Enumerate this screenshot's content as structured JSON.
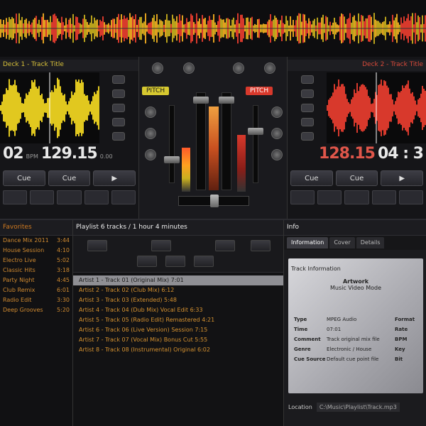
{
  "deck_left": {
    "title": "Deck 1 - Track Title",
    "time": "02",
    "bpm_label": "BPM",
    "bpm": "129.15",
    "pitch_suffix": "0.00",
    "cue_labels": [
      "Cue",
      "Cue",
      "▶"
    ],
    "color": "#e1c81f"
  },
  "deck_right": {
    "title": "Deck 2 - Track Title",
    "bpm": "128.15",
    "time": "04 : 3",
    "cue_labels": [
      "Cue",
      "Cue",
      "▶"
    ],
    "color": "#d8392c"
  },
  "mixer": {
    "pitch_left": "PITCH",
    "pitch_right": "PITCH"
  },
  "browser": {
    "folders_header": "Favorites",
    "folders": [
      {
        "name": "Dance Mix 2011",
        "len": "3:44"
      },
      {
        "name": "House Session",
        "len": "4:10"
      },
      {
        "name": "Electro Live",
        "len": "5:02"
      },
      {
        "name": "Classic Hits",
        "len": "3:18"
      },
      {
        "name": "Party Night",
        "len": "4:45"
      },
      {
        "name": "Club Remix",
        "len": "6:01"
      },
      {
        "name": "Radio Edit",
        "len": "3:30"
      },
      {
        "name": "Deep Grooves",
        "len": "5:20"
      }
    ],
    "playlist_header": "Playlist 6 tracks / 1 hour 4 minutes",
    "tracks": [
      "Artist 1 - Track 01 (Original Mix) 7:01",
      "Artist 2 - Track 02 (Club Mix) 6:12",
      "Artist 3 - Track 03 (Extended) 5:48",
      "Artist 4 - Track 04 (Dub Mix) Vocal Edit 6:33",
      "Artist 5 - Track 05 (Radio Edit) Remastered 4:21",
      "Artist 6 - Track 06 (Live Version) Session 7:15",
      "Artist 7 - Track 07 (Vocal Mix) Bonus Cut 5:55",
      "Artist 8 - Track 08 (Instrumental) Original 6:02"
    ],
    "info_header": "Info",
    "info_tabs": [
      "Information",
      "Cover",
      "Details"
    ],
    "info_title": "Track Information",
    "info_card_header": "Artwork",
    "info_card_sub": "Music Video Mode",
    "info_rows": [
      {
        "k": "Type",
        "v": "MPEG Audio",
        "x": "Format"
      },
      {
        "k": "Time",
        "v": "07:01",
        "x": "Rate"
      },
      {
        "k": "Comment",
        "v": "Track original mix file",
        "x": "BPM"
      },
      {
        "k": "Genre",
        "v": "Electronic / House",
        "x": "Key"
      },
      {
        "k": "Cue Source",
        "v": "Default cue point file",
        "x": "Bit"
      }
    ],
    "info_bottom": [
      "Location",
      "C:\\Music\\Playlist\\Track.mp3"
    ]
  }
}
